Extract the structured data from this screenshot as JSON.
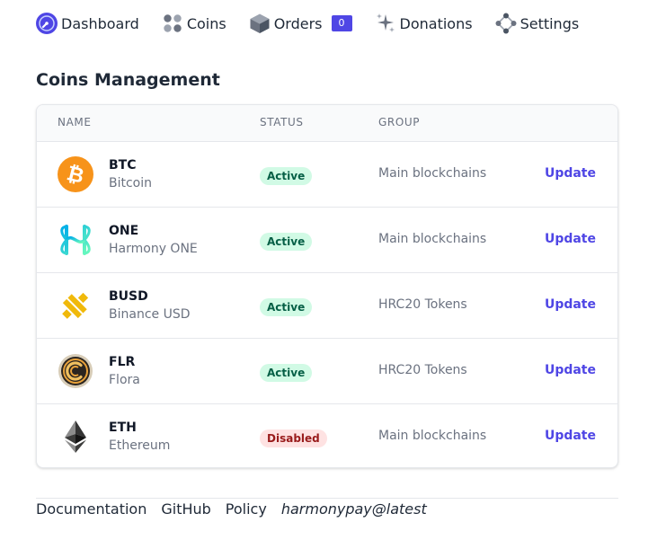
{
  "nav": {
    "items": [
      {
        "label": "Dashboard",
        "icon": "dashboard-icon"
      },
      {
        "label": "Coins",
        "icon": "coins-icon"
      },
      {
        "label": "Orders",
        "icon": "cube-icon",
        "count": "0"
      },
      {
        "label": "Donations",
        "icon": "sparkles-icon"
      },
      {
        "label": "Settings",
        "icon": "nodes-icon"
      }
    ]
  },
  "page": {
    "title": "Coins Management"
  },
  "table": {
    "columns": [
      "Name",
      "Status",
      "Group"
    ],
    "rows": [
      {
        "symbol": "BTC",
        "name": "Bitcoin",
        "status": "Active",
        "group": "Main blockchains",
        "action": "Update",
        "logo": "bitcoin-logo"
      },
      {
        "symbol": "ONE",
        "name": "Harmony ONE",
        "status": "Active",
        "group": "Main blockchains",
        "action": "Update",
        "logo": "harmony-logo"
      },
      {
        "symbol": "BUSD",
        "name": "Binance USD",
        "status": "Active",
        "group": "HRC20 Tokens",
        "action": "Update",
        "logo": "binance-usd-logo"
      },
      {
        "symbol": "FLR",
        "name": "Flora",
        "status": "Active",
        "group": "HRC20 Tokens",
        "action": "Update",
        "logo": "flora-logo"
      },
      {
        "symbol": "ETH",
        "name": "Ethereum",
        "status": "Disabled",
        "group": "Main blockchains",
        "action": "Update",
        "logo": "ethereum-logo"
      }
    ]
  },
  "footer": {
    "links": [
      "Documentation",
      "GitHub",
      "Policy"
    ],
    "version": "harmonypay@latest"
  },
  "colors": {
    "accent": "#4f46e5",
    "active_bg": "#d1fae5",
    "active_text": "#065f46",
    "disabled_bg": "#fee2e2",
    "disabled_text": "#991b1b",
    "bitcoin": "#f7931a",
    "busd": "#f0b90b"
  }
}
